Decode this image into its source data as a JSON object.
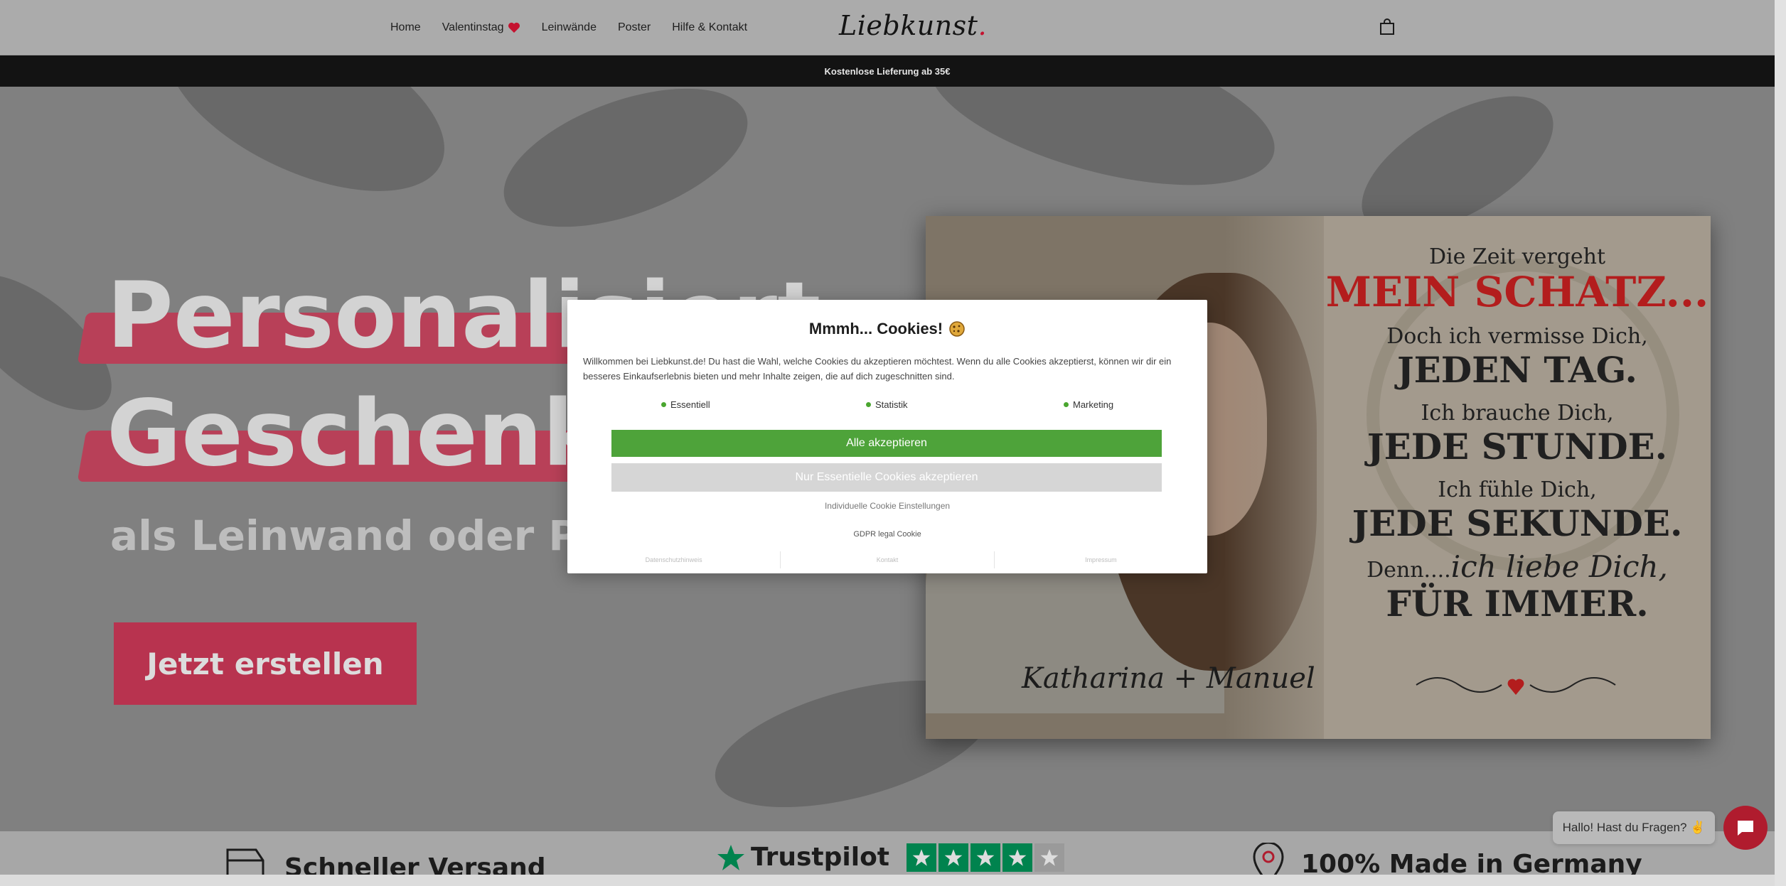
{
  "header": {
    "nav": [
      {
        "label": "Home"
      },
      {
        "label": "Valentinstag"
      },
      {
        "label": "Leinwände"
      },
      {
        "label": "Poster"
      },
      {
        "label": "Hilfe & Kontakt"
      }
    ],
    "logo_text": "Liebkunst",
    "logo_dot": ".",
    "cart_icon": "shopping-bag-icon"
  },
  "announcement": "Kostenlose Lieferung ab 35€",
  "hero": {
    "title_line1": "Personalisiert",
    "title_line2": "Geschenke",
    "subtitle": "als Leinwand oder Poster",
    "cta_label": "Jetzt erstellen",
    "accent_color": "#b8334f"
  },
  "canvas_print": {
    "line1": "Die Zeit vergeht",
    "line2": "MEIN SCHATZ...",
    "line3": "Doch ich vermisse Dich,",
    "line4": "JEDEN TAG.",
    "line5": "Ich brauche Dich,",
    "line6": "JEDE STUNDE.",
    "line7": "Ich fühle Dich,",
    "line8": "JEDE SEKUNDE.",
    "line9a": "Denn....",
    "line9b": "ich liebe Dich,",
    "line10": "FÜR IMMER.",
    "names": "Katharina + Manuel"
  },
  "trustbar": {
    "item1": "Schneller Versand",
    "item2": "Trustpilot",
    "item3": "100% Made in Germany"
  },
  "chat": {
    "bubble_text": "Hallo! Hast du Fragen? ✌",
    "button_icon": "chat-icon"
  },
  "cookie_modal": {
    "title": "Mmmh... Cookies!",
    "body": "Willkommen bei Liebkunst.de! Du hast die Wahl, welche Cookies du akzeptieren möchtest. Wenn du alle Cookies akzeptierst, können wir dir ein besseres Einkaufserlebnis bieten und mehr Inhalte zeigen, die auf dich zugeschnitten sind.",
    "categories": [
      "Essentiell",
      "Statistik",
      "Marketing"
    ],
    "accept_all_label": "Alle akzeptieren",
    "accept_essential_label": "Nur Essentielle Cookies akzeptieren",
    "individual_label": "Individuelle Cookie Einstellungen",
    "gdpr_label": "GDPR legal Cookie",
    "footer_links": [
      "Datenschutzhinweis",
      "Kontakt",
      "Impressum"
    ],
    "accept_color": "#4ea33a"
  }
}
